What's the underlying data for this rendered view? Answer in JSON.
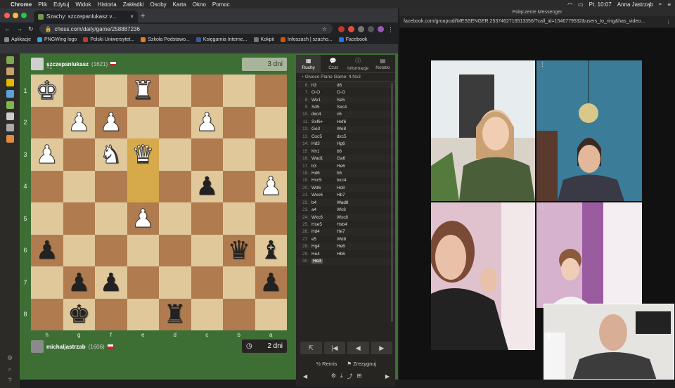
{
  "menubar": {
    "apple": "",
    "app": "Chrome",
    "items": [
      "Plik",
      "Edytuj",
      "Widok",
      "Historia",
      "Zakładki",
      "Osoby",
      "Karta",
      "Okno",
      "Pomoc"
    ],
    "clock": "Pt. 10:07",
    "user": "Anna Jastrząb"
  },
  "chrome": {
    "tab_title": "Szachy: szczepanlukasz v...",
    "tab_close": "×",
    "new_tab": "+",
    "url": "chess.com/daily/game/258887236",
    "bookmarks": [
      {
        "label": "Aplikacje",
        "color": "#888"
      },
      {
        "label": "PNGWing logo",
        "color": "#3ea0e0"
      },
      {
        "label": "Polski Uniwersytet...",
        "color": "#c0392b"
      },
      {
        "label": "Szkoła Podstawo...",
        "color": "#e67e22"
      },
      {
        "label": "Księgarnia Interne...",
        "color": "#3b5998"
      },
      {
        "label": "Kokpit",
        "color": "#777"
      },
      {
        "label": "Infoszach | szacho...",
        "color": "#d35400"
      },
      {
        "label": "Facebook",
        "color": "#1877f2"
      }
    ]
  },
  "game": {
    "top_player": {
      "name": "szczepanlukasz",
      "rating": "(1621)",
      "extra": "+1"
    },
    "bottom_player": {
      "name": "michaljastrzab",
      "rating": "(1606)"
    },
    "top_timer": "3 dni",
    "bottom_timer": "2 dni",
    "ranks": [
      "1",
      "2",
      "3",
      "4",
      "5",
      "6",
      "7",
      "8"
    ],
    "files": [
      "h",
      "g",
      "f",
      "e",
      "d",
      "c",
      "b",
      "a"
    ],
    "board": [
      [
        "wK",
        "",
        "",
        "wR",
        "",
        "",
        "",
        ""
      ],
      [
        "",
        "wP",
        "wP",
        "",
        "",
        "wP",
        "",
        ""
      ],
      [
        "wP",
        "",
        "wN",
        "wQ",
        "",
        "",
        "",
        ""
      ],
      [
        "",
        "",
        "",
        "",
        "",
        "bP",
        "",
        "wP"
      ],
      [
        "",
        "",
        "",
        "wP",
        "",
        "",
        "",
        ""
      ],
      [
        "bP",
        "",
        "",
        "",
        "",
        "",
        "bQ",
        "bB"
      ],
      [
        "",
        "bP",
        "bP",
        "",
        "",
        "",
        "",
        "bP"
      ],
      [
        "",
        "bK",
        "",
        "",
        "bR",
        "",
        "",
        ""
      ]
    ],
    "highlights": [
      [
        2,
        3
      ],
      [
        3,
        3
      ]
    ]
  },
  "panel": {
    "tabs": [
      {
        "label": "Ruchy",
        "icon": "▦"
      },
      {
        "label": "Czat",
        "icon": "💬"
      },
      {
        "label": "Informacje",
        "icon": "ⓘ"
      },
      {
        "label": "Notatki",
        "icon": "▤"
      }
    ],
    "opening": "Giuoco Piano Game: 4.Nc3",
    "moves": [
      [
        "6.",
        "h3",
        "d6"
      ],
      [
        "7.",
        "O-O",
        "O-O"
      ],
      [
        "8.",
        "We1",
        "Se5"
      ],
      [
        "9.",
        "Sd5",
        "Sxc4"
      ],
      [
        "10.",
        "dxc4",
        "c6"
      ],
      [
        "11.",
        "Sxf6+",
        "Hxf6"
      ],
      [
        "12.",
        "Ge3",
        "We8"
      ],
      [
        "13.",
        "Gxc5",
        "dxc5"
      ],
      [
        "14.",
        "Hd3",
        "Hg6"
      ],
      [
        "15.",
        "Kh1",
        "b6"
      ],
      [
        "16.",
        "Wad1",
        "Ga6"
      ],
      [
        "17.",
        "b3",
        "He6"
      ],
      [
        "18.",
        "Hd6",
        "b5"
      ],
      [
        "19.",
        "Hxc5",
        "bxc4"
      ],
      [
        "20.",
        "Wd6",
        "Hc8"
      ],
      [
        "21.",
        "Wxc6",
        "Hb7"
      ],
      [
        "22.",
        "b4",
        "Wad8"
      ],
      [
        "23.",
        "a4",
        "Wc8"
      ],
      [
        "24.",
        "Wxc6",
        "Wxc8"
      ],
      [
        "25.",
        "Hxe5",
        "Hxb4"
      ],
      [
        "26.",
        "Hd4",
        "He7"
      ],
      [
        "27.",
        "e5",
        "Wd8"
      ],
      [
        "28.",
        "Hg4",
        "He6"
      ],
      [
        "29.",
        "He4",
        "Hb6"
      ],
      [
        "30.",
        "He3",
        ""
      ]
    ],
    "nav": [
      "⇱",
      "|◀",
      "◀",
      "▶"
    ],
    "remis": "½ Remis",
    "resign": "⚑ Zrezygnuj"
  },
  "messenger": {
    "title": "Połączenie Messenger",
    "url": "facebook.com/groupcall/MESSENGER:2537462716513356/?call_id=1546779532&users_to_ring&has_video..."
  }
}
